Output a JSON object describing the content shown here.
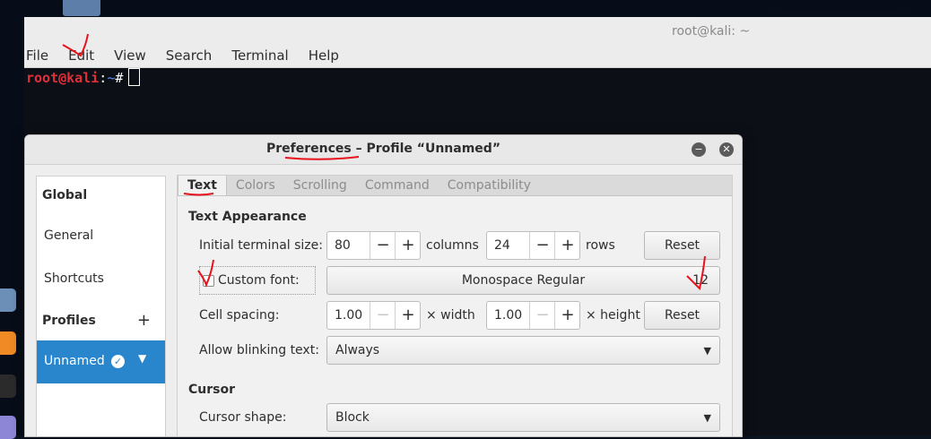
{
  "terminal": {
    "title": "root@kali: ~",
    "menu": [
      "File",
      "Edit",
      "View",
      "Search",
      "Terminal",
      "Help"
    ],
    "prompt": {
      "user_host": "root@kali",
      "sep": ":",
      "path": "~",
      "symbol": "#"
    }
  },
  "dialog": {
    "title": "Preferences – Profile “Unnamed”",
    "sidebar": {
      "global_heading": "Global",
      "general": "General",
      "shortcuts": "Shortcuts",
      "profiles_heading": "Profiles",
      "add_icon": "plus-icon",
      "selected_profile": "Unnamed"
    },
    "tabs": [
      "Text",
      "Colors",
      "Scrolling",
      "Command",
      "Compatibility"
    ],
    "text_appearance": {
      "heading": "Text Appearance",
      "initial_size_label": "Initial terminal size:",
      "columns_value": "80",
      "columns_unit": "columns",
      "rows_value": "24",
      "rows_unit": "rows",
      "reset_label": "Reset",
      "custom_font_label": "Custom font:",
      "custom_font_checked": false,
      "font_name": "Monospace Regular",
      "font_size": "12",
      "cell_spacing_label": "Cell spacing:",
      "width_value": "1.00",
      "width_unit": "× width",
      "height_value": "1.00",
      "height_unit": "× height",
      "reset2_label": "Reset",
      "blink_label": "Allow blinking text:",
      "blink_value": "Always"
    },
    "cursor": {
      "heading": "Cursor",
      "shape_label": "Cursor shape:",
      "shape_value": "Block"
    }
  },
  "colors": {
    "accent": "#2a86cc",
    "prompt_user": "#e0303a",
    "annotation": "#e8121c"
  }
}
